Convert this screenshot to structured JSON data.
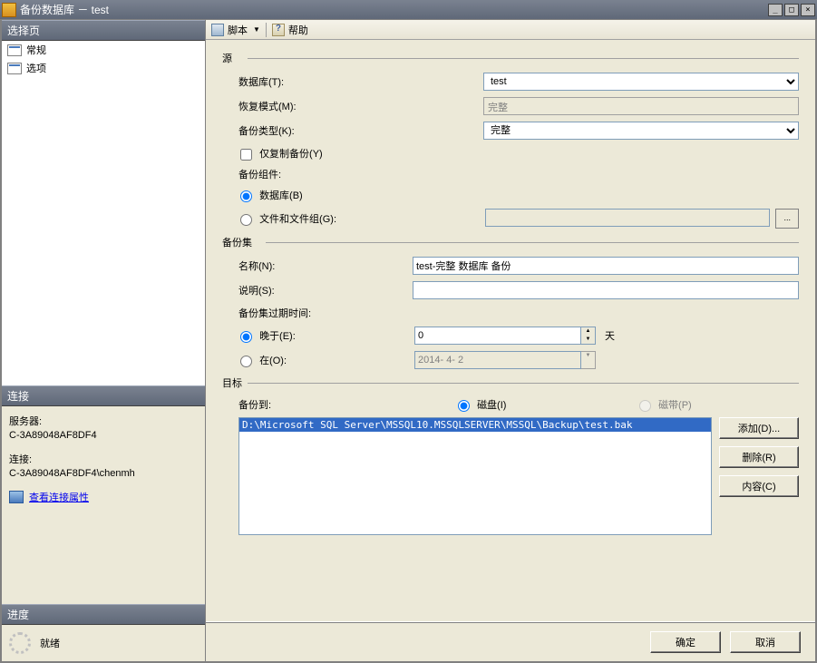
{
  "window": {
    "title": "备份数据库 － test"
  },
  "left": {
    "select_page_header": "选择页",
    "page_general": "常规",
    "page_options": "选项",
    "connection_header": "连接",
    "server_label": "服务器:",
    "server_value": "C-3A89048AF8DF4",
    "conn_label": "连接:",
    "conn_value": "C-3A89048AF8DF4\\chenmh",
    "view_conn_props": "查看连接属性",
    "progress_header": "进度",
    "ready": "就绪"
  },
  "toolbar": {
    "script": "脚本",
    "help": "帮助"
  },
  "source": {
    "group": "源",
    "database_label": "数据库(T):",
    "database_value": "test",
    "recovery_label": "恢复模式(M):",
    "recovery_value": "完整",
    "backup_type_label": "备份类型(K):",
    "backup_type_value": "完整",
    "copy_only": "仅复制备份(Y)",
    "components_label": "备份组件:",
    "comp_database": "数据库(B)",
    "comp_filegroup": "文件和文件组(G):"
  },
  "backupset": {
    "group": "备份集",
    "name_label": "名称(N):",
    "name_value": "test-完整 数据库 备份",
    "desc_label": "说明(S):",
    "desc_value": "",
    "expiry_label": "备份集过期时间:",
    "after_label": "晚于(E):",
    "after_value": "0",
    "after_unit": "天",
    "on_label": "在(O):",
    "on_value": "2014- 4- 2"
  },
  "destination": {
    "group": "目标",
    "backup_to": "备份到:",
    "disk": "磁盘(I)",
    "tape": "磁带(P)",
    "path": "D:\\Microsoft SQL Server\\MSSQL10.MSSQLSERVER\\MSSQL\\Backup\\test.bak",
    "add": "添加(D)...",
    "remove": "删除(R)",
    "contents": "内容(C)"
  },
  "footer": {
    "ok": "确定",
    "cancel": "取消"
  }
}
